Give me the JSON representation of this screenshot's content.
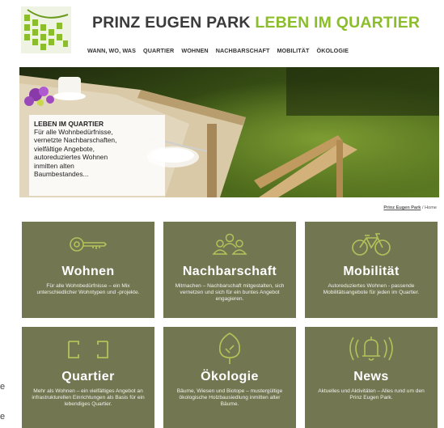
{
  "header": {
    "title_part1": "PRINZ EUGEN PARK",
    "title_part2": "LEBEN IM QUARTIER",
    "nav": [
      "WANN, WO, WAS",
      "QUARTIER",
      "WOHNEN",
      "NACHBARSCHAFT",
      "MOBILITÄT",
      "ÖKOLOGIE"
    ]
  },
  "hero": {
    "title": "LEBEN IM QUARTIER",
    "text": "Für alle Wohnbedürfnisse,\nvernetzte Nachbarschaften,\nvielfältige Angebote,\nautoreduziertes Wohnen\ninmitten alten\nBaumbestandes..."
  },
  "breadcrumb": {
    "link": "Prinz Eugen Park",
    "separator": "/",
    "current": "Home"
  },
  "tiles": [
    {
      "title": "Wohnen",
      "icon": "key-icon",
      "desc": "Für alle Wohnbedürfnisse – ein Mix unterschiedlicher Wohntypen und -projekte."
    },
    {
      "title": "Nachbarschaft",
      "icon": "people-icon",
      "desc": "Mitmachen – Nachbarschaft mitgestalten, sich vernetzen und sich für ein buntes Angebot engagieren."
    },
    {
      "title": "Mobilität",
      "icon": "bicycle-icon",
      "desc": "Autoreduziertes Wohnen - passende Mobilitätsangebote für jeden im Quartier."
    },
    {
      "title": "Quartier",
      "icon": "brackets-icon",
      "desc": "Mehr als Wohnen – ein vielfältiges Angebot an infrastrukturellen Einrichtungen als Basis für ein lebendiges Quartier."
    },
    {
      "title": "Ökologie",
      "icon": "tree-icon",
      "desc": "Bäume, Wiesen und Biotope – mustergültige ökologische Holzbausiedlung inmitten alter Bäume."
    },
    {
      "title": "News",
      "icon": "bell-icon",
      "desc": "Aktuelles und Aktivitäten – Alles rund um den Prinz Eugen Park."
    }
  ],
  "side_fragments": [
    "e",
    "e"
  ],
  "colors": {
    "tile_bg": "#727752",
    "title_green": "#8cbd2b"
  }
}
